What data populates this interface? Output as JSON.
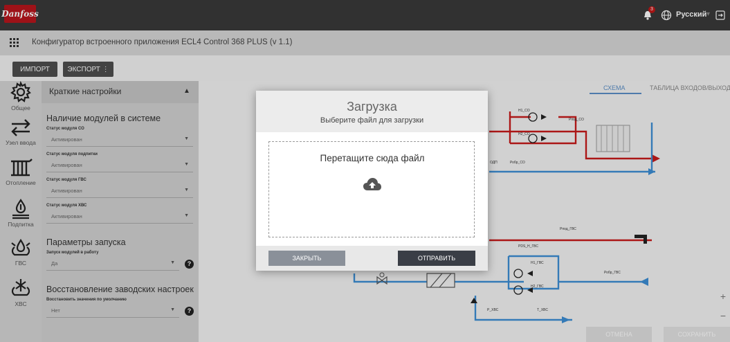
{
  "header": {
    "logo_text": "Danfoss",
    "notification_count": "3",
    "language": "Русский",
    "app_title": "Конфигуратор встроенного приложения ECL4 Control 368 PLUS (v 1.1)"
  },
  "toolbar": {
    "import_label": "ИМПОРТ",
    "export_label": "ЭКСПОРТ ⋮"
  },
  "sidebar": {
    "items": [
      {
        "label": "Общее",
        "icon": "gear-icon"
      },
      {
        "label": "Узел ввода",
        "icon": "arrows-exchange-icon"
      },
      {
        "label": "Отопление",
        "icon": "radiator-icon"
      },
      {
        "label": "Подпитка",
        "icon": "water-fill-icon"
      },
      {
        "label": "ГВС",
        "icon": "hot-water-icon"
      },
      {
        "label": "ХВС",
        "icon": "cold-water-icon"
      }
    ]
  },
  "panel": {
    "title": "Краткие настройки",
    "modules_title": "Наличие модулей в системе",
    "modules": [
      {
        "label": "Статус модуля СО",
        "value": "Активирован"
      },
      {
        "label": "Статус модуля подпитки",
        "value": "Активирован"
      },
      {
        "label": "Статус модуля ГВС",
        "value": "Активирован"
      },
      {
        "label": "Статус модуля ХВС",
        "value": "Активирован"
      }
    ],
    "launch_title": "Параметры запуска",
    "launch_label": "Запуск модулей в работу",
    "launch_value": "Да",
    "restore_title": "Восстановление заводских настроек",
    "restore_label": "Восстановить значения по умолчанию",
    "restore_value": "Нет"
  },
  "main": {
    "tab_schema": "СХЕМА",
    "tab_table": "ТАБЛИЦА ВХОДОВ/ВЫХОДОВ",
    "zoom_in": "+",
    "zoom_out": "−",
    "cancel_label": "ОТМЕНА",
    "save_label": "СОХРАНИТЬ",
    "schema_labels": {
      "h1_co": "H1_CO",
      "h2_co": "H2_CO",
      "pnod_co": "Рпод_CO",
      "pobr_co": "Робр_CO",
      "pod": "ОДП",
      "pnod_gvs": "Рпод_ГВС",
      "pds_h_gvs": "PDS_H_ГВС",
      "h1_gvs": "H1_ГВС",
      "h2_gvs": "H2_ГВС",
      "pobr_gvs": "Робр_ГВС",
      "p_hvs": "P_ХВС",
      "t_hvs": "T_ХВС"
    }
  },
  "modal": {
    "title": "Загрузка",
    "subtitle": "Выберите файл для загрузки",
    "drop_text": "Перетащите сюда файл",
    "close_label": "ЗАКРЫТЬ",
    "send_label": "ОТПРАВИТЬ"
  },
  "colors": {
    "danfoss_red": "#b8161c",
    "supply_red": "#c81a1a",
    "return_blue": "#3d8fd6",
    "accent_tab": "#5b8fc7"
  }
}
